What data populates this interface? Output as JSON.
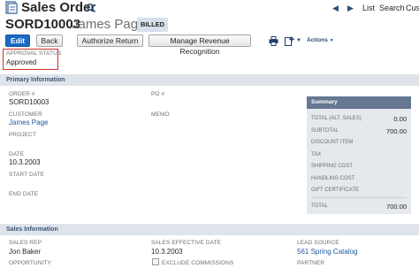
{
  "header": {
    "page_title": "Sales Order",
    "nav_list": "List",
    "nav_search": "Search",
    "nav_customize": "Cus"
  },
  "record": {
    "number": "SORD10003",
    "name": "James Page",
    "status_badge": "BILLED"
  },
  "buttons": {
    "edit": "Edit",
    "back": "Back",
    "authorize_return": "Authorize Return",
    "manage_revenue": "Manage Revenue Recognition",
    "actions": "Actions"
  },
  "approval": {
    "label": "APPROVAL STATUS",
    "value": "Approved"
  },
  "primary": {
    "title": "Primary Information",
    "order_label": "ORDER #",
    "order_value": "SORD10003",
    "customer_label": "CUSTOMER",
    "customer_value": "James Page",
    "project_label": "PROJECT",
    "date_label": "DATE",
    "date_value": "10.3.2003",
    "start_date_label": "START DATE",
    "end_date_label": "END DATE",
    "po_label": "PO #",
    "memo_label": "MEMO"
  },
  "summary": {
    "title": "Summary",
    "rows": [
      {
        "label": "TOTAL (ALT. SALES)",
        "value": "0.00"
      },
      {
        "label": "SUBTOTAL",
        "value": "700.00"
      },
      {
        "label": "DISCOUNT ITEM",
        "value": ""
      },
      {
        "label": "TAX",
        "value": ""
      },
      {
        "label": "SHIPPING COST",
        "value": ""
      },
      {
        "label": "HANDLING COST",
        "value": ""
      },
      {
        "label": "GIFT CERTIFICATE",
        "value": ""
      }
    ],
    "total_label": "TOTAL",
    "total_value": "700.00"
  },
  "sales": {
    "title": "Sales Information",
    "rep_label": "SALES REP",
    "rep_value": "Jon Baker",
    "opportunity_label": "OPPORTUNITY",
    "effective_date_label": "SALES EFFECTIVE DATE",
    "effective_date_value": "10.3.2003",
    "exclude_commissions_label": "EXCLUDE COMMISSIONS",
    "lead_source_label": "LEAD SOURCE",
    "lead_source_value": "561 Spring Catalog",
    "partner_label": "PARTNER"
  },
  "colors": {
    "primary_button": "#1b6ac3",
    "approval_highlight": "#d0302b",
    "summary_header": "#657791",
    "section_header": "#dfe4eb",
    "link": "#1e5aa6"
  },
  "icons": [
    "sales-order-icon",
    "search-icon",
    "back-arrow-icon",
    "forward-arrow-icon",
    "print-icon",
    "add-icon",
    "caret-down-icon"
  ]
}
